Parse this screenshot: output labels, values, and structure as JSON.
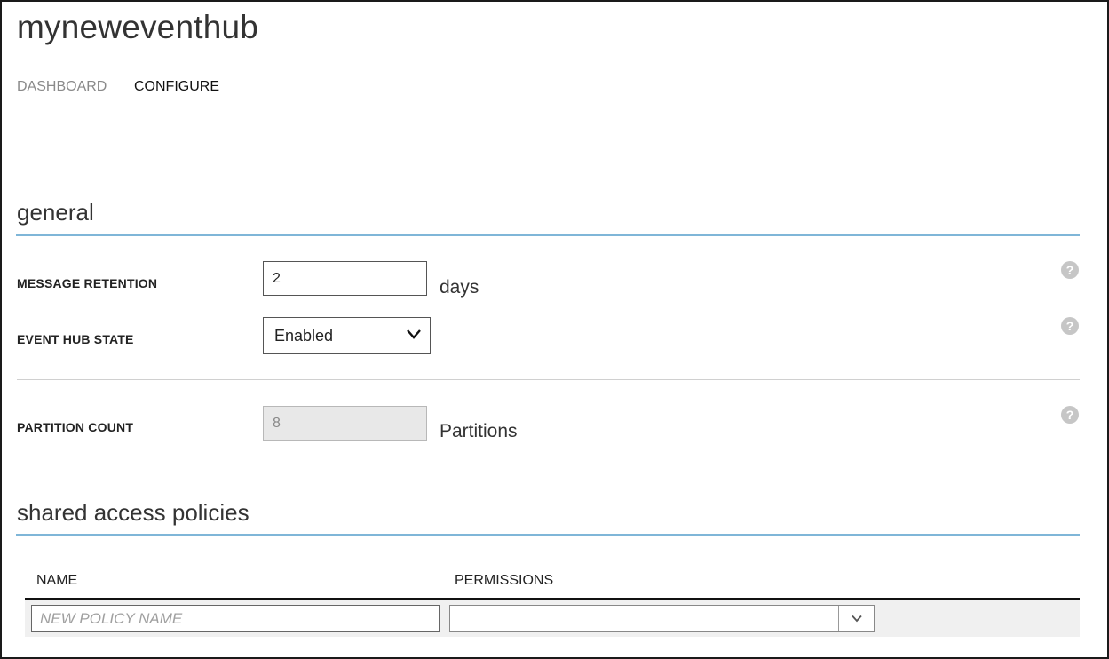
{
  "page": {
    "title": "myneweventhub"
  },
  "tabs": [
    {
      "label": "DASHBOARD",
      "active": false
    },
    {
      "label": "CONFIGURE",
      "active": true
    }
  ],
  "general": {
    "title": "general",
    "message_retention": {
      "label": "MESSAGE RETENTION",
      "value": "2",
      "unit": "days"
    },
    "event_hub_state": {
      "label": "EVENT HUB STATE",
      "selected": "Enabled"
    },
    "partition_count": {
      "label": "PARTITION COUNT",
      "value": "8",
      "unit": "Partitions",
      "disabled": true
    },
    "help_glyph": "?"
  },
  "shared_access": {
    "title": "shared access policies",
    "columns": [
      "NAME",
      "PERMISSIONS"
    ],
    "new_policy": {
      "placeholder": "NEW POLICY NAME",
      "permissions_value": ""
    }
  },
  "colors": {
    "accent_rule": "#7fb6d8",
    "help_icon": "#c6c6c6",
    "disabled_field": "#e8e8e8"
  },
  "icons": [
    "chevron-down-icon",
    "help-icon"
  ]
}
